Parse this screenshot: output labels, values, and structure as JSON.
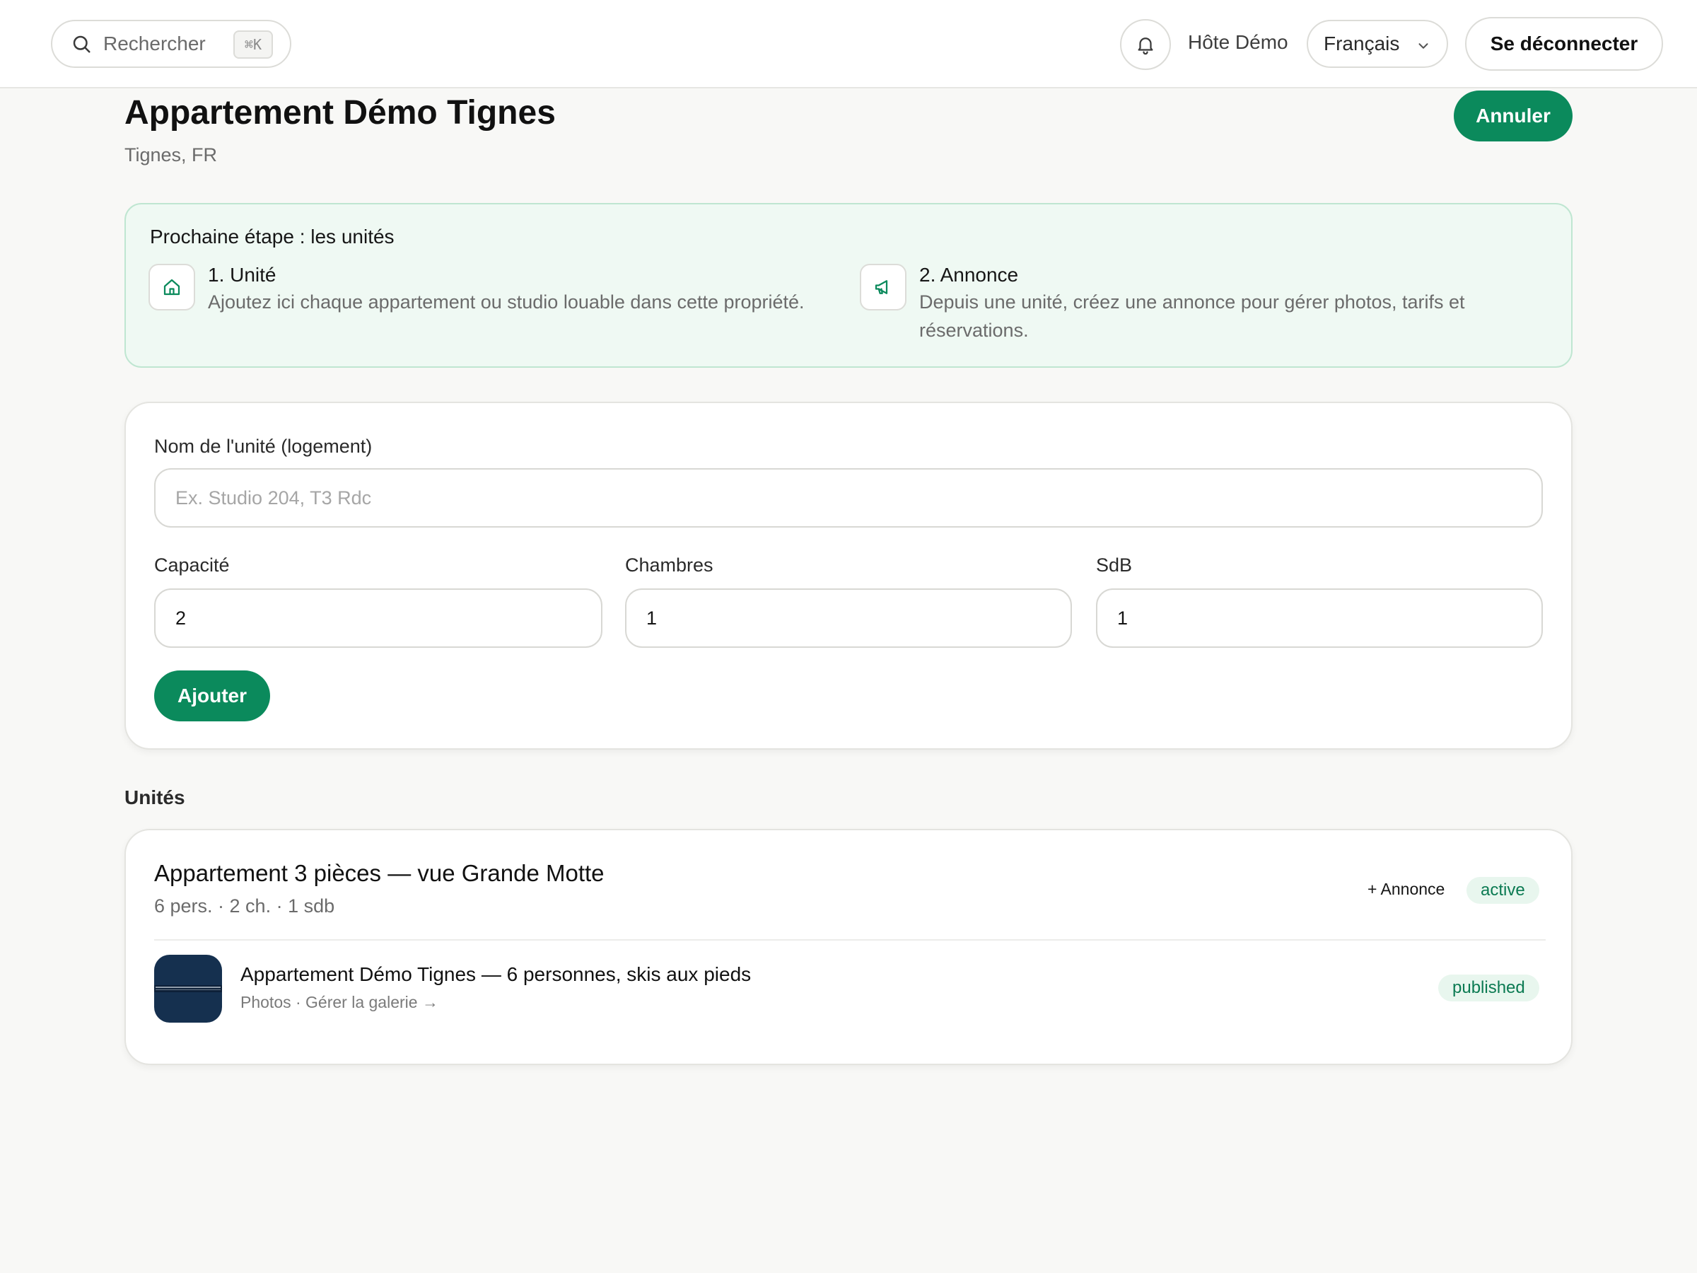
{
  "topbar": {
    "search_label": "Rechercher",
    "search_shortcut": "⌘K",
    "user_name": "Hôte Démo",
    "language": "Français",
    "logout_label": "Se déconnecter"
  },
  "page": {
    "title": "Appartement Démo Tignes",
    "location": "Tignes, FR",
    "cancel_label": "Annuler"
  },
  "next_step": {
    "title": "Prochaine étape : les unités",
    "steps": [
      {
        "title": "1. Unité",
        "description": "Ajoutez ici chaque appartement ou studio louable dans cette propriété.",
        "icon": "home-icon"
      },
      {
        "title": "2. Annonce",
        "description": "Depuis une unité, créez une annonce pour gérer photos, tarifs et réservations.",
        "icon": "megaphone-icon"
      }
    ]
  },
  "form": {
    "name_label": "Nom de l'unité (logement)",
    "name_placeholder": "Ex. Studio 204, T3 Rdc",
    "capacity_label": "Capacité",
    "capacity_value": "2",
    "bedrooms_label": "Chambres",
    "bedrooms_value": "1",
    "bathrooms_label": "SdB",
    "bathrooms_value": "1",
    "add_label": "Ajouter"
  },
  "units": {
    "heading": "Unités",
    "items": [
      {
        "title": "Appartement 3 pièces — vue Grande Motte",
        "meta": "6 pers. · 2 ch. · 1 sdb",
        "add_listing_label": "+ Annonce",
        "status": "active",
        "listings": [
          {
            "title": "Appartement Démo Tignes — 6 personnes, skis aux pieds",
            "subtitle": "Photos · Gérer la galerie →",
            "status": "published"
          }
        ]
      }
    ]
  },
  "colors": {
    "accent": "#0b8a5c",
    "badge_bg": "#e8f6ee",
    "badge_text": "#0b7a52",
    "next_step_bg": "#eff9f3"
  }
}
